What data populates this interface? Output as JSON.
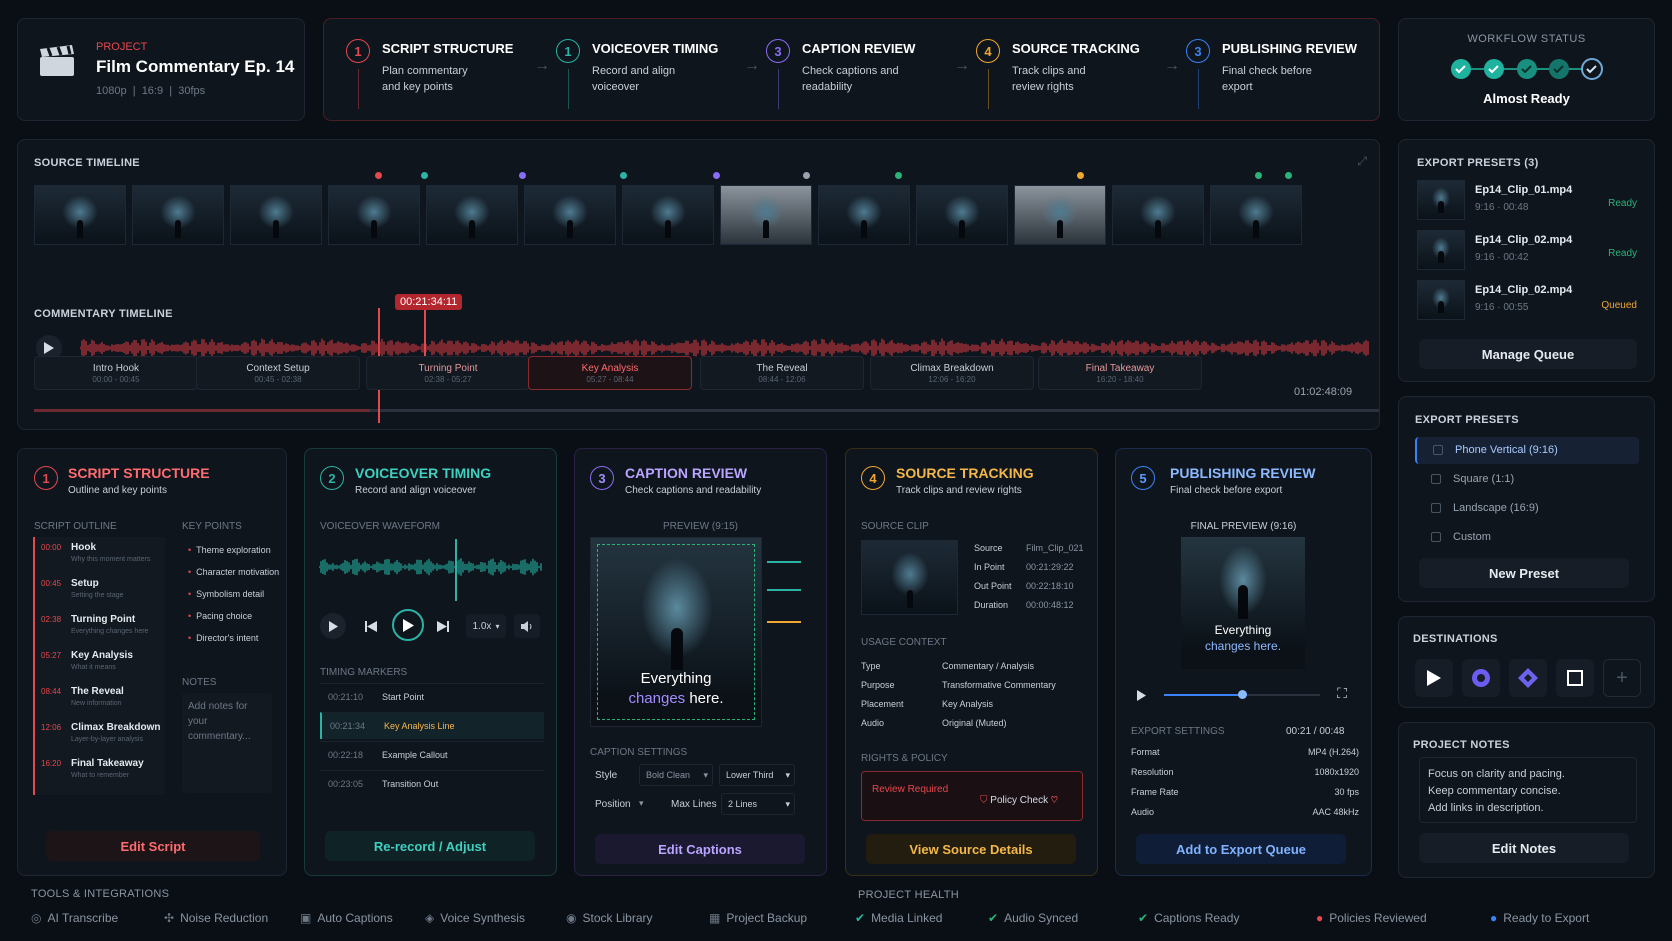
{
  "header": {
    "project_label": "PROJECT",
    "project_title": "Film Commentary Ep. 14",
    "res": "1080p",
    "ratio": "16:9",
    "fps": "30fps"
  },
  "steps": [
    {
      "num": "1",
      "title": "SCRIPT STRUCTURE",
      "desc": "Plan commentary and key points",
      "color": "#e5484d"
    },
    {
      "num": "1",
      "title": "VOICEOVER TIMING",
      "desc": "Record and align voiceover",
      "color": "#2bb3a5"
    },
    {
      "num": "3",
      "title": "CAPTION REVIEW",
      "desc": "Check captions and readability",
      "color": "#8b6cf6"
    },
    {
      "num": "4",
      "title": "SOURCE TRACKING",
      "desc": "Track clips and review rights",
      "color": "#f0a730"
    },
    {
      "num": "3",
      "title": "PUBLISHING REVIEW",
      "desc": "Final check before export",
      "color": "#3b82f6"
    }
  ],
  "workflow": {
    "label": "WORKFLOW STATUS",
    "status": "Almost Ready"
  },
  "source_timeline": {
    "label": "SOURCE TIMELINE"
  },
  "commentary_timeline": {
    "label": "COMMENTARY TIMELINE",
    "playhead": "00:21:34:11",
    "end_time": "01:02:48:09",
    "segments": [
      {
        "name": "Intro Hook",
        "time": "00:00 - 00:45"
      },
      {
        "name": "Context Setup",
        "time": "00:45 - 02:38"
      },
      {
        "name": "Turning Point",
        "time": "02:38 - 05:27"
      },
      {
        "name": "Key Analysis",
        "time": "05:27 - 08:44"
      },
      {
        "name": "The Reveal",
        "time": "08:44 - 12:06"
      },
      {
        "name": "Climax Breakdown",
        "time": "12:06 - 16:20"
      },
      {
        "name": "Final Takeaway",
        "time": "16:20 - 18:40"
      }
    ]
  },
  "export_queue": {
    "label": "EXPORT PRESETS (3)",
    "items": [
      {
        "name": "Ep14_Clip_01.mp4",
        "meta": "9:16 · 00:48",
        "status": "Ready"
      },
      {
        "name": "Ep14_Clip_02.mp4",
        "meta": "9:16 · 00:42",
        "status": "Ready"
      },
      {
        "name": "Ep14_Clip_02.mp4",
        "meta": "9:16 · 00:55",
        "status": "Queued"
      }
    ],
    "button": "Manage Queue"
  },
  "presets": {
    "label": "EXPORT PRESETS",
    "items": [
      "Phone Vertical (9:16)",
      "Square (1:1)",
      "Landscape (16:9)",
      "Custom"
    ],
    "button": "New Preset"
  },
  "destinations": {
    "label": "DESTINATIONS"
  },
  "notes": {
    "label": "PROJECT NOTES",
    "lines": [
      "Focus on clarity and pacing.",
      "Keep commentary concise.",
      "Add links in description."
    ],
    "button": "Edit Notes"
  },
  "card1": {
    "num": "1",
    "title": "SCRIPT STRUCTURE",
    "sub": "Outline and key points",
    "outline_label": "SCRIPT OUTLINE",
    "keypoints_label": "KEY POINTS",
    "notes_label": "NOTES",
    "notes_placeholder": "Add notes for your commentary...",
    "outline": [
      {
        "t": "00:00",
        "name": "Hook",
        "desc": "Why this moment matters"
      },
      {
        "t": "00:45",
        "name": "Setup",
        "desc": "Setting the stage"
      },
      {
        "t": "02:38",
        "name": "Turning Point",
        "desc": "Everything changes here"
      },
      {
        "t": "05:27",
        "name": "Key Analysis",
        "desc": "What it means"
      },
      {
        "t": "08:44",
        "name": "The Reveal",
        "desc": "New information"
      },
      {
        "t": "12:06",
        "name": "Climax Breakdown",
        "desc": "Layer-by-layer analysis"
      },
      {
        "t": "16:20",
        "name": "Final Takeaway",
        "desc": "What to remember"
      }
    ],
    "keypoints": [
      "Theme exploration",
      "Character motivation",
      "Symbolism detail",
      "Pacing choice",
      "Director's intent"
    ],
    "button": "Edit Script"
  },
  "card2": {
    "num": "2",
    "title": "VOICEOVER TIMING",
    "sub": "Record and align voiceover",
    "wave_label": "VOICEOVER WAVEFORM",
    "speed": "1.0x",
    "markers_label": "TIMING MARKERS",
    "markers": [
      {
        "t": "00:21:10",
        "name": "Start Point"
      },
      {
        "t": "00:21:34",
        "name": "Key Analysis Line"
      },
      {
        "t": "00:22:18",
        "name": "Example Callout"
      },
      {
        "t": "00:23:05",
        "name": "Transition Out"
      }
    ],
    "button": "Re-record / Adjust"
  },
  "card3": {
    "num": "3",
    "title": "CAPTION REVIEW",
    "sub": "Check captions and readability",
    "preview_label": "PREVIEW (9:15)",
    "caption_line1": "Everything",
    "caption_line2a": "changes",
    "caption_line2b": "here.",
    "settings_label": "CAPTION SETTINGS",
    "style_label": "Style",
    "style_val": "Bold Clean",
    "font_val": "Lower Third",
    "position_label": "Position",
    "maxlines_label": "Max Lines",
    "maxlines_val": "2 Lines",
    "button": "Edit Captions"
  },
  "card4": {
    "num": "4",
    "title": "SOURCE TRACKING",
    "sub": "Track clips and review rights",
    "clip_label": "SOURCE CLIP",
    "clip_info": [
      {
        "k": "Source",
        "v": "Film_Clip_021"
      },
      {
        "k": "In Point",
        "v": "00:21:29:22"
      },
      {
        "k": "Out Point",
        "v": "00:22:18:10"
      },
      {
        "k": "Duration",
        "v": "00:00:48:12"
      }
    ],
    "usage_label": "USAGE CONTEXT",
    "usage": [
      {
        "k": "Type",
        "v": "Commentary / Analysis"
      },
      {
        "k": "Purpose",
        "v": "Transformative Commentary"
      },
      {
        "k": "Placement",
        "v": "Key Analysis"
      },
      {
        "k": "Audio",
        "v": "Original (Muted)"
      }
    ],
    "rights_label": "RIGHTS & POLICY",
    "review": "Review Required",
    "policy": "Policy Check",
    "button": "View Source Details"
  },
  "card5": {
    "num": "5",
    "title": "PUBLISHING REVIEW",
    "sub": "Final check before export",
    "preview_label": "FINAL PREVIEW (9:16)",
    "caption_line1": "Everything",
    "caption_line2": "changes here.",
    "time": "00:21 / 00:48",
    "settings_label": "EXPORT SETTINGS",
    "settings": [
      {
        "k": "Format",
        "v": "MP4 (H.264)"
      },
      {
        "k": "Resolution",
        "v": "1080x1920"
      },
      {
        "k": "Frame Rate",
        "v": "30 fps"
      },
      {
        "k": "Audio",
        "v": "AAC 48kHz"
      }
    ],
    "button": "Add to Export Queue"
  },
  "tools": {
    "label": "TOOLS & INTEGRATIONS",
    "items": [
      "AI Transcribe",
      "Noise Reduction",
      "Auto Captions",
      "Voice Synthesis",
      "Stock Library",
      "Project Backup"
    ]
  },
  "health": {
    "label": "PROJECT HEALTH",
    "items": [
      {
        "name": "Media Linked",
        "color": "#2bb3a5"
      },
      {
        "name": "Audio Synced",
        "color": "#2bb37a"
      },
      {
        "name": "Captions Ready",
        "color": "#2bb37a"
      },
      {
        "name": "Policies Reviewed",
        "color": "#e5484d"
      },
      {
        "name": "Ready to Export",
        "color": "#3b82f6"
      }
    ]
  }
}
